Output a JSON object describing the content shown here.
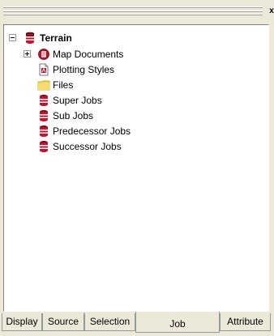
{
  "window": {
    "close_glyph": "x"
  },
  "tree": {
    "root": {
      "label": "Terrain",
      "icon": "job-icon"
    },
    "children": [
      {
        "label": "Map Documents",
        "icon": "map-document-icon",
        "expandable": true
      },
      {
        "label": "Plotting Styles",
        "icon": "plot-style-icon"
      },
      {
        "label": "Files",
        "icon": "folder-icon"
      },
      {
        "label": "Super Jobs",
        "icon": "job-icon"
      },
      {
        "label": "Sub Jobs",
        "icon": "job-icon"
      },
      {
        "label": "Predecessor Jobs",
        "icon": "job-icon"
      },
      {
        "label": "Successor Jobs",
        "icon": "job-icon"
      }
    ]
  },
  "tabs": [
    {
      "label": "Display",
      "active": false
    },
    {
      "label": "Source",
      "active": false
    },
    {
      "label": "Selection",
      "active": false
    },
    {
      "label": "Job",
      "active": true
    },
    {
      "label": "Attribute",
      "active": false
    }
  ],
  "colors": {
    "panel": "#ece9d8",
    "job_icon_red": "#c8102e",
    "folder_yellow": "#f5d64c"
  }
}
